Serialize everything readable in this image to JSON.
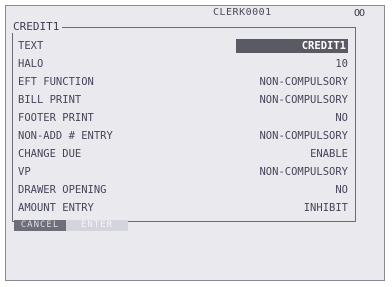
{
  "header": {
    "clerk": "CLERK0001",
    "status_icon": "OO"
  },
  "panel": {
    "title": "CREDIT1",
    "rows": [
      {
        "label": "TEXT",
        "value": "CREDIT1",
        "highlight": true
      },
      {
        "label": "HALO",
        "value": "10"
      },
      {
        "label": "EFT FUNCTION",
        "value": "NON-COMPULSORY"
      },
      {
        "label": "BILL PRINT",
        "value": "NON-COMPULSORY"
      },
      {
        "label": "FOOTER PRINT",
        "value": "NO"
      },
      {
        "label": "NON-ADD # ENTRY",
        "value": "NON-COMPULSORY"
      },
      {
        "label": "CHANGE DUE",
        "value": "ENABLE"
      },
      {
        "label": "VP",
        "value": "NON-COMPULSORY"
      },
      {
        "label": "DRAWER OPENING",
        "value": "NO"
      },
      {
        "label": "AMOUNT ENTRY",
        "value": "INHIBIT"
      }
    ]
  },
  "buttons": {
    "cancel": "CANCEL",
    "enter": "ENTER"
  },
  "colors": {
    "screen_bg": "#eaeaee",
    "highlight_bg": "#5a5a64",
    "text": "#45455a"
  }
}
